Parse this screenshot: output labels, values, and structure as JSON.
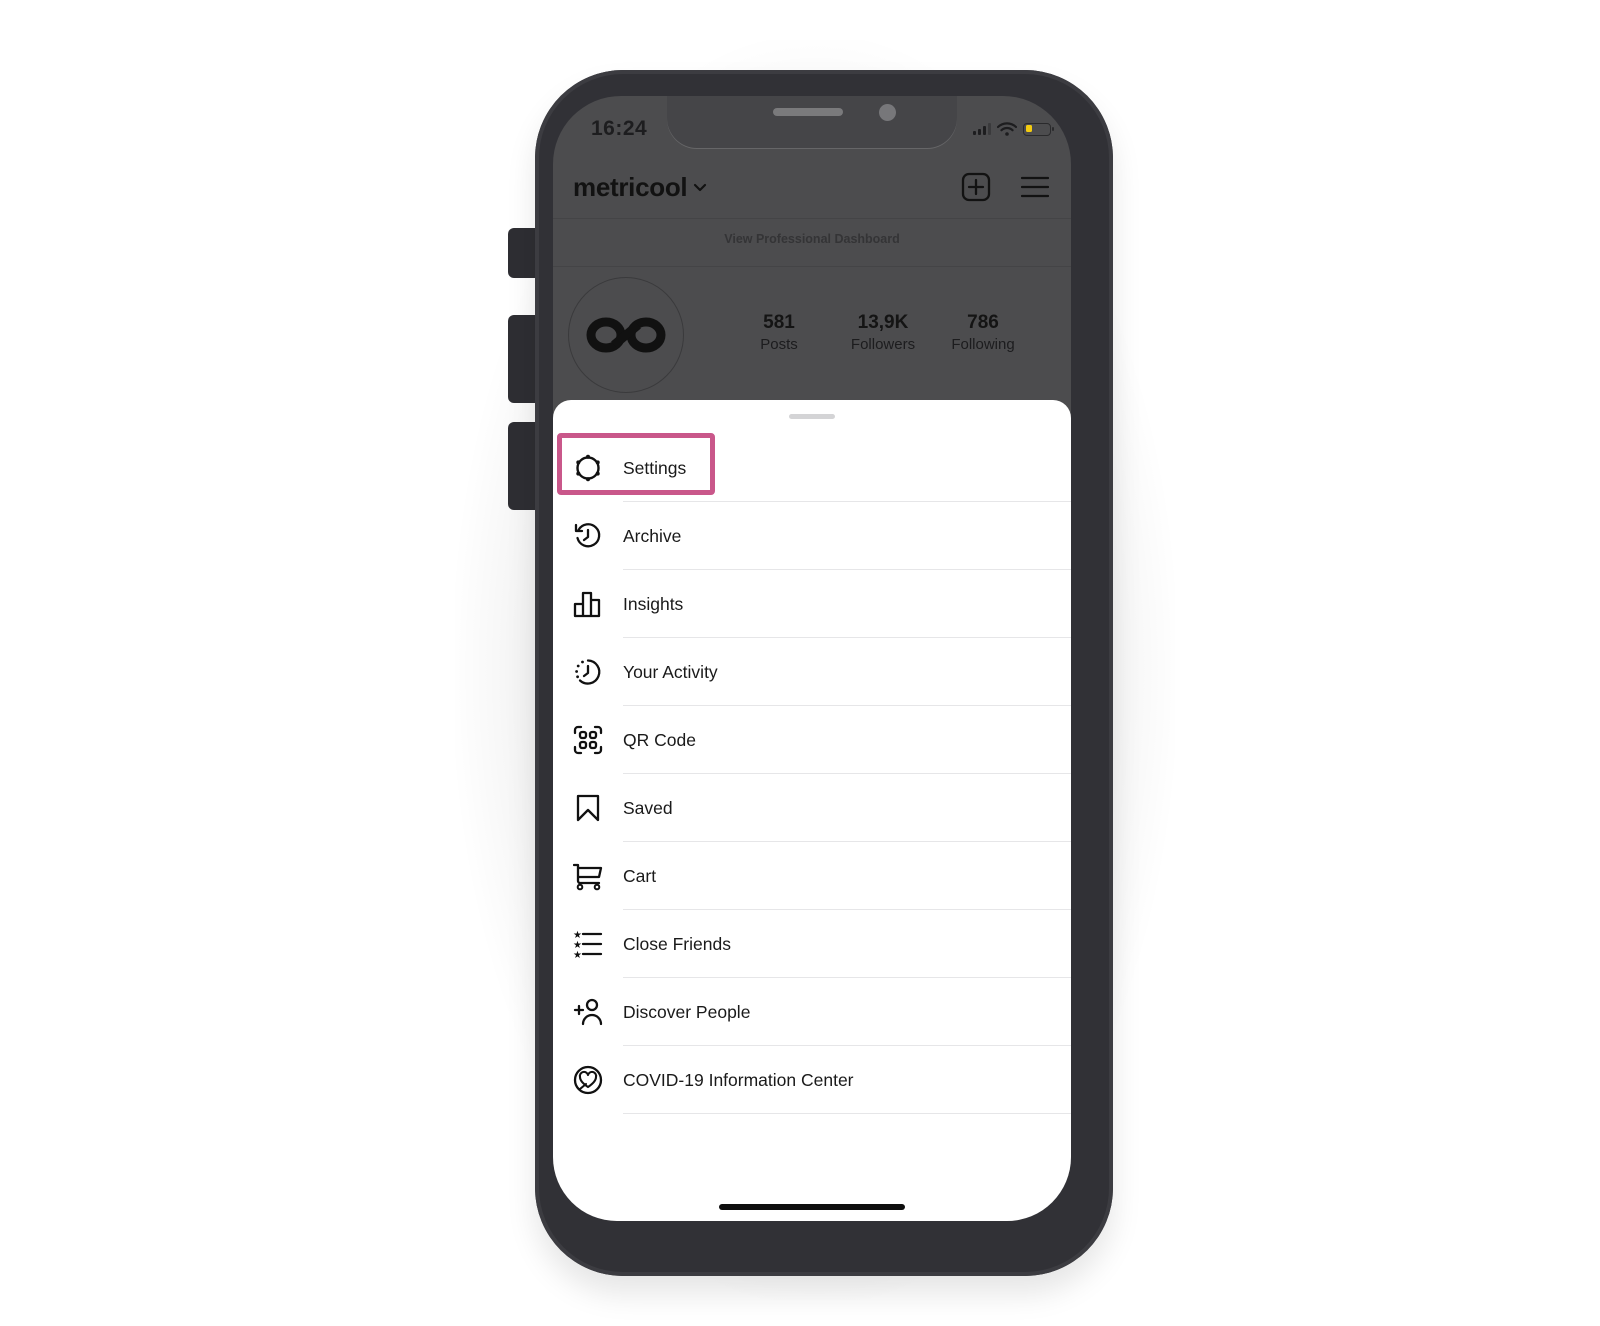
{
  "status_bar": {
    "time": "16:24",
    "icons": [
      "cellular-signal-icon",
      "wifi-icon",
      "battery-low-icon"
    ],
    "battery_level": 0.3,
    "battery_color": "#f4cc10"
  },
  "profile_header": {
    "username": "metricool",
    "username_dropdown_icon": "chevron-down-icon",
    "actions": [
      {
        "name": "create-post-button",
        "icon": "plus-square-icon"
      },
      {
        "name": "menu-button",
        "icon": "hamburger-menu-icon"
      }
    ],
    "dashboard_link": "View Professional Dashboard"
  },
  "profile": {
    "avatar_icon": "metricool-infinity-logo",
    "stats": [
      {
        "value": "581",
        "label": "Posts"
      },
      {
        "value": "13,9K",
        "label": "Followers"
      },
      {
        "value": "786",
        "label": "Following"
      }
    ]
  },
  "menu_sheet": {
    "highlight_color": "#c9578a",
    "highlighted_item": "Settings",
    "items": [
      {
        "label": "Settings",
        "icon": "settings-gear-icon"
      },
      {
        "label": "Archive",
        "icon": "archive-history-icon"
      },
      {
        "label": "Insights",
        "icon": "insights-bar-chart-icon"
      },
      {
        "label": "Your Activity",
        "icon": "activity-clock-icon"
      },
      {
        "label": "QR Code",
        "icon": "qr-code-icon"
      },
      {
        "label": "Saved",
        "icon": "bookmark-icon"
      },
      {
        "label": "Cart",
        "icon": "cart-icon"
      },
      {
        "label": "Close Friends",
        "icon": "close-friends-list-icon"
      },
      {
        "label": "Discover People",
        "icon": "add-person-icon"
      },
      {
        "label": "COVID-19 Information Center",
        "icon": "covid-heart-icon"
      }
    ]
  }
}
